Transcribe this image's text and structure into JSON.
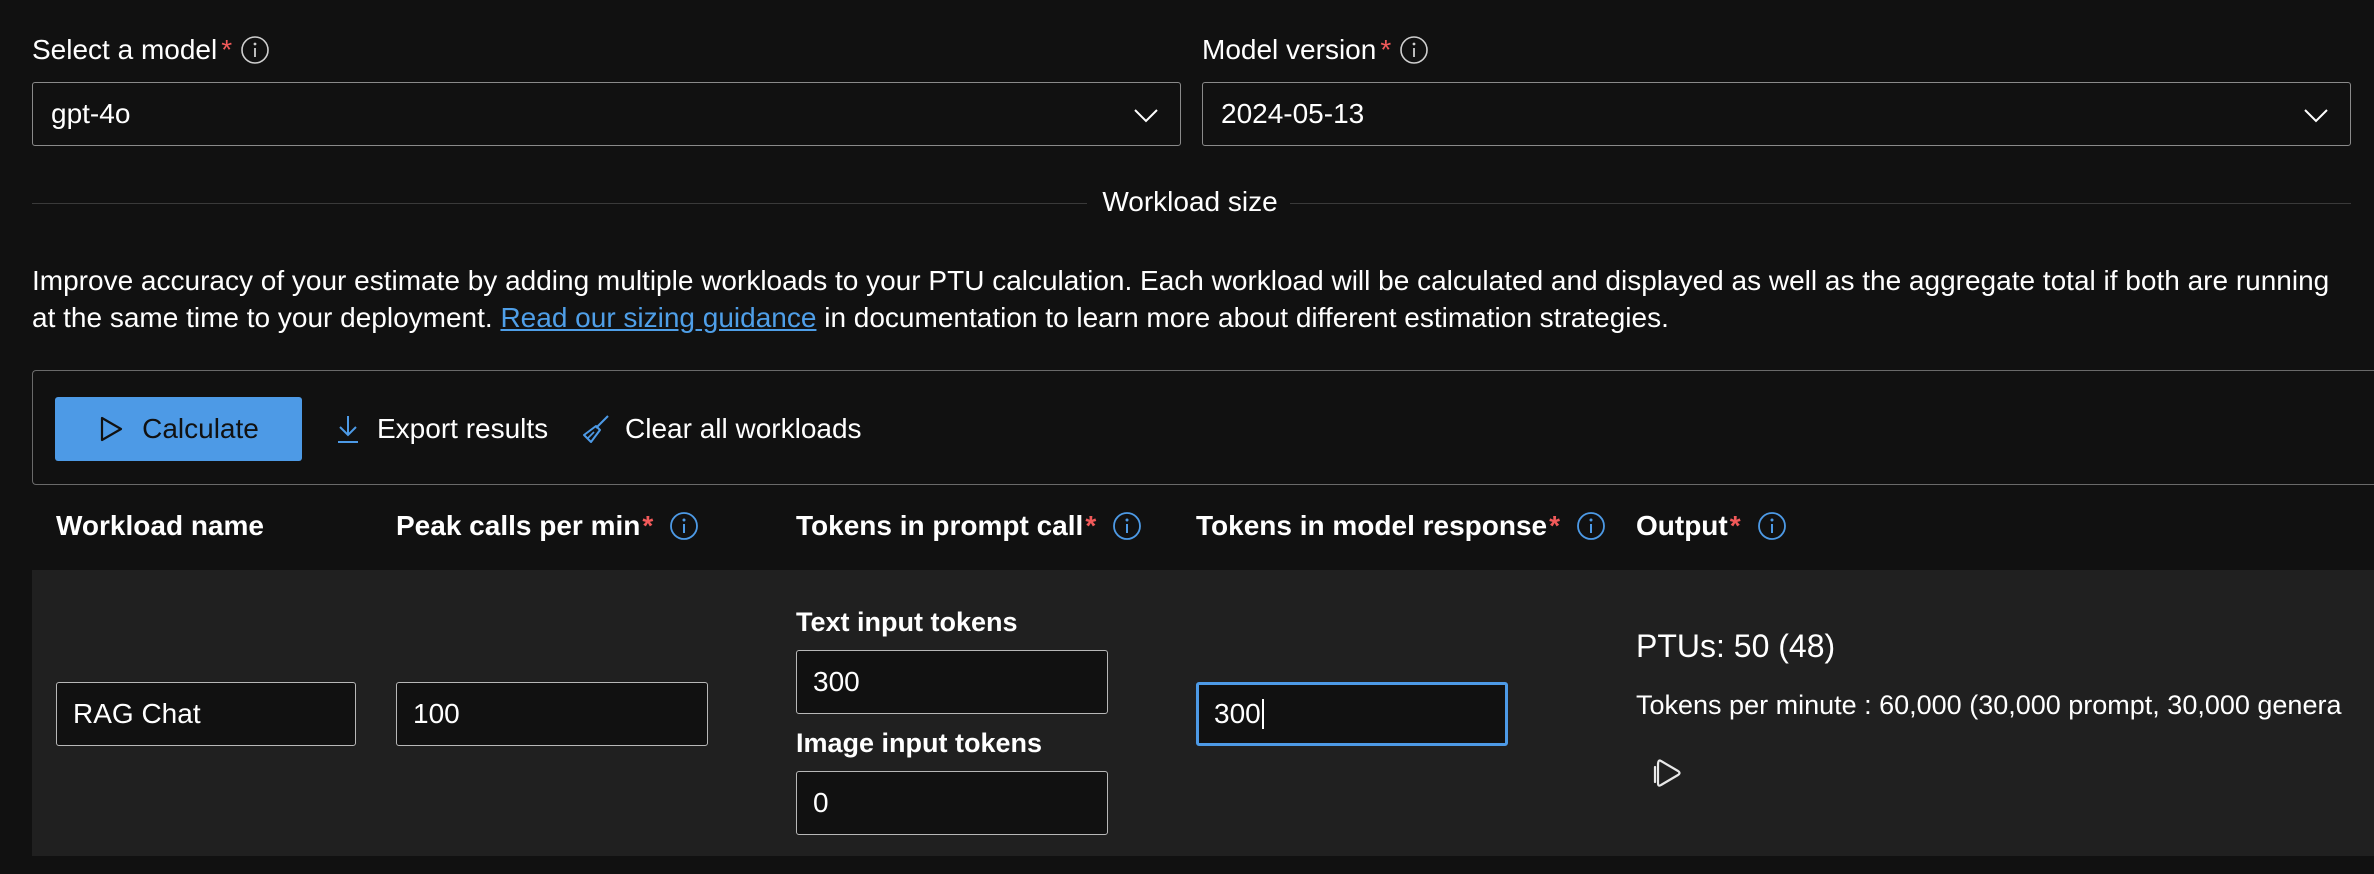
{
  "model": {
    "label": "Select a model",
    "required_mark": "*",
    "value": "gpt-4o"
  },
  "version": {
    "label": "Model version",
    "required_mark": "*",
    "value": "2024-05-13"
  },
  "workload_section": {
    "title": "Workload size",
    "description_part1": "Improve accuracy of your estimate by adding multiple workloads to your PTU calculation. Each workload will be calculated and displayed as well as the aggregate total if both are running at the same time to your deployment. ",
    "link_text": "Read our sizing guidance",
    "description_part2": " in documentation to learn more about different estimation strategies."
  },
  "toolbar": {
    "calculate_label": "Calculate",
    "export_label": "Export results",
    "clear_label": "Clear all workloads"
  },
  "table": {
    "headers": {
      "workload_name": "Workload name",
      "peak_calls": "Peak calls per min",
      "tokens_prompt": "Tokens in prompt call",
      "tokens_response": "Tokens in model response",
      "output": "Output",
      "required_mark": "*"
    },
    "row": {
      "workload_name": "RAG Chat",
      "peak_calls": "100",
      "text_input_label": "Text input tokens",
      "text_input_value": "300",
      "image_input_label": "Image input tokens",
      "image_input_value": "0",
      "response_tokens": "300",
      "ptus": "PTUs: 50 (48)",
      "tokens_per_minute": "Tokens per minute : 60,000 (30,000 prompt, 30,000 genera"
    }
  },
  "colors": {
    "background": "#111111",
    "row_background": "#202020",
    "accent": "#4d9ae6",
    "required": "#f25a5a",
    "link": "#4f9fe8"
  },
  "icons": {
    "info": "info-icon",
    "chevron": "chevron-down-icon",
    "play": "play-icon",
    "download": "download-icon",
    "broom": "broom-icon",
    "copilot": "copilot-play-icon"
  }
}
